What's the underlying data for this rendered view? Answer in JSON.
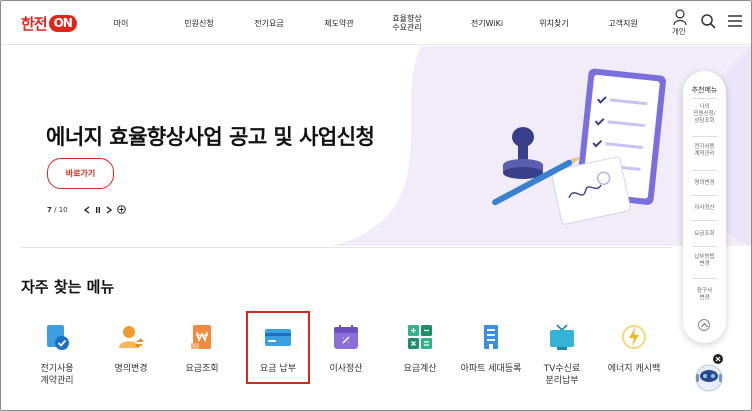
{
  "header": {
    "logo_text": "한전",
    "logo_on": "ON",
    "nav": [
      "마이",
      "민원신청",
      "전기요금",
      "제도약관",
      "효율향상\n수요관리",
      "전기WiKi",
      "위치찾기",
      "고객지원"
    ],
    "user_label": "개인"
  },
  "banner": {
    "title": "에너지 효율향상사업 공고 및 사업신청",
    "button_label": "바로가기",
    "page_current": "7",
    "page_total": "/ 10"
  },
  "frequent_menu": {
    "title": "자주 찾는 메뉴",
    "items": [
      {
        "label": "전기사용\n계약관리",
        "icon": "doc-check-icon",
        "color": "#3aa0e0"
      },
      {
        "label": "명의변경",
        "icon": "person-change-icon",
        "color": "#f29a2e"
      },
      {
        "label": "요금조회",
        "icon": "won-bill-icon",
        "color": "#f08a3c"
      },
      {
        "label": "요금 납부",
        "icon": "card-icon",
        "color": "#3aa0e0"
      },
      {
        "label": "이사정산",
        "icon": "calendar-icon",
        "color": "#8a6fd8"
      },
      {
        "label": "요금계산",
        "icon": "calculator-icon",
        "color": "#2fb48a"
      },
      {
        "label": "아파트 세대등록",
        "icon": "apartment-icon",
        "color": "#3a8fe0"
      },
      {
        "label": "TV수신료\n분리납부",
        "icon": "tv-icon",
        "color": "#34b3d6"
      },
      {
        "label": "에너지 캐시백",
        "icon": "energy-bolt-icon",
        "color": "#f2b51e"
      }
    ]
  },
  "side_panel": {
    "title": "추천메뉴",
    "items": [
      "나의\n민원신청/\n상담조회",
      "전기사용\n계약관리",
      "명의변경",
      "이사정산",
      "요금조회",
      "납부방법\n변경",
      "청구서\n변경"
    ]
  },
  "colors": {
    "brand": "#e1251b",
    "accent_red": "#d52b1e",
    "banner_bg": "#ece6f7"
  }
}
